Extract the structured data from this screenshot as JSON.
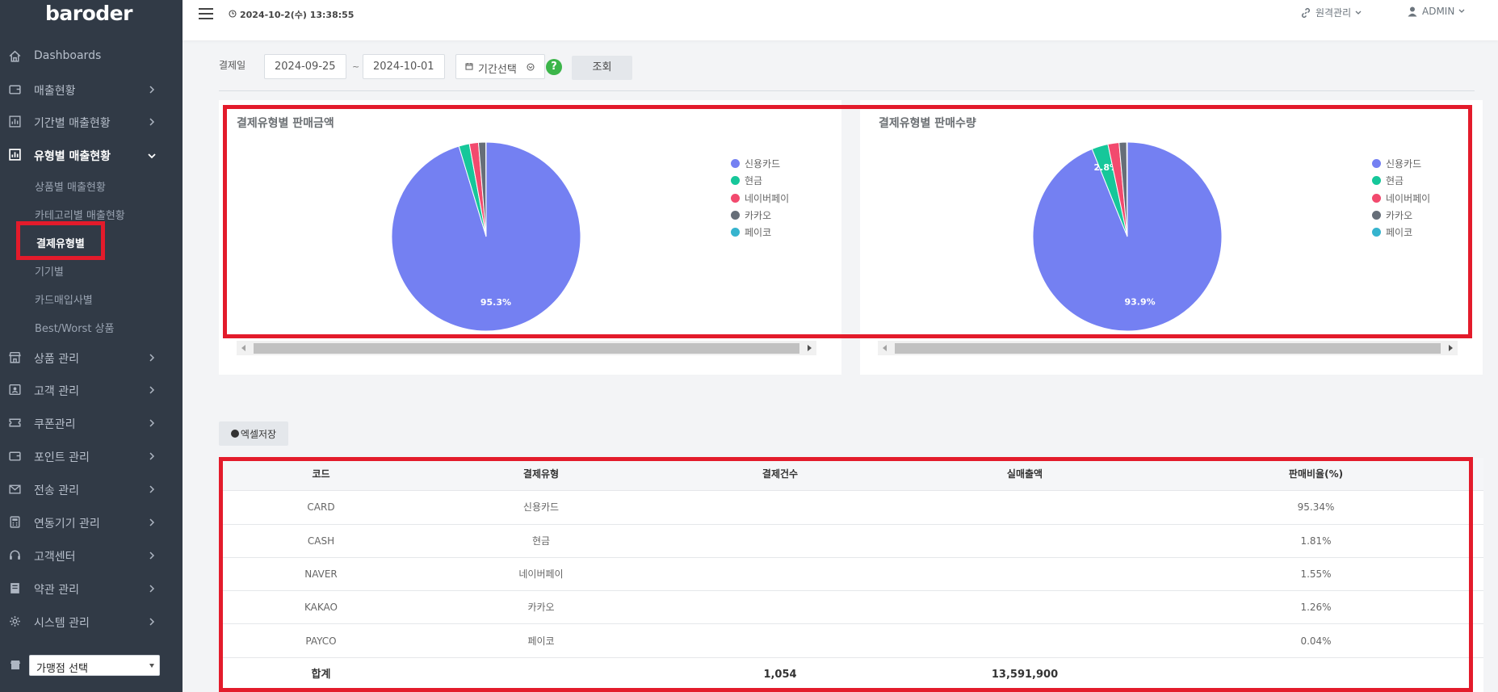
{
  "app": {
    "logo": "baroder"
  },
  "sidebar": {
    "items": [
      {
        "label": "Dashboards",
        "icon": "home-icon",
        "chevron": false
      },
      {
        "label": "매출현황",
        "icon": "wallet-icon",
        "chevron": true
      },
      {
        "label": "기간별 매출현황",
        "icon": "bar-chart-icon",
        "chevron": true
      },
      {
        "label": "유형별 매출현황",
        "icon": "chart-icon",
        "chevron": true,
        "expanded": true,
        "active": true
      },
      {
        "label": "상품 관리",
        "icon": "store-icon",
        "chevron": true
      },
      {
        "label": "고객 관리",
        "icon": "contact-icon",
        "chevron": true
      },
      {
        "label": "쿠폰관리",
        "icon": "ticket-icon",
        "chevron": true
      },
      {
        "label": "포인트 관리",
        "icon": "wallet-icon",
        "chevron": true
      },
      {
        "label": "전송 관리",
        "icon": "mail-icon",
        "chevron": true
      },
      {
        "label": "연동기기 관리",
        "icon": "calculator-icon",
        "chevron": true
      },
      {
        "label": "고객센터",
        "icon": "headset-icon",
        "chevron": true
      },
      {
        "label": "약관 관리",
        "icon": "book-icon",
        "chevron": true
      },
      {
        "label": "시스템 관리",
        "icon": "gear-icon",
        "chevron": true
      }
    ],
    "subitems": [
      {
        "label": "상품별 매출현황"
      },
      {
        "label": "카테고리별 매출현황"
      },
      {
        "label": "결제유형별",
        "current": true
      },
      {
        "label": "기기별"
      },
      {
        "label": "카드매입사별"
      },
      {
        "label": "Best/Worst 상품"
      }
    ],
    "store_select": {
      "value": "가맹점 선택"
    }
  },
  "topbar": {
    "datetime": "2024-10-2(수) 13:38:55",
    "remote_label": "원격관리",
    "user_label": "ADMIN"
  },
  "filter": {
    "label": "결제일",
    "start_date": "2024-09-25",
    "tilde": "~",
    "end_date": "2024-10-01",
    "period_button": "기간선택",
    "help": "?",
    "search_button": "조회"
  },
  "colors": {
    "credit_card": "#7480f2",
    "cash": "#16c79a",
    "naver": "#f24a6e",
    "kakao": "#666e78",
    "payco": "#36b4ce",
    "highlight": "#e31b2b"
  },
  "chart_data": [
    {
      "type": "pie",
      "title": "결제유형별 판매금액",
      "categories": [
        "신용카드",
        "현금",
        "네이버페이",
        "카카오",
        "페이코"
      ],
      "values": [
        95.34,
        1.81,
        1.55,
        1.26,
        0.04
      ],
      "data_labels": [
        "95.3%",
        "",
        "",
        "",
        ""
      ],
      "legend_position": "right"
    },
    {
      "type": "pie",
      "title": "결제유형별 판매수량",
      "categories": [
        "신용카드",
        "현금",
        "네이버페이",
        "카카오",
        "페이코"
      ],
      "values": [
        93.9,
        2.8,
        1.9,
        1.3,
        0.1
      ],
      "data_labels": [
        "93.9%",
        "2.8%",
        "",
        "",
        ""
      ],
      "legend_position": "right"
    }
  ],
  "excel_button": "엑셀저장",
  "table": {
    "headers": [
      "코드",
      "결제유형",
      "결제건수",
      "실매출액",
      "판매비율(%)"
    ],
    "rows": [
      [
        "CARD",
        "신용카드",
        "",
        "",
        "95.34%"
      ],
      [
        "CASH",
        "현금",
        "",
        "",
        "1.81%"
      ],
      [
        "NAVER",
        "네이버페이",
        "",
        "",
        "1.55%"
      ],
      [
        "KAKAO",
        "카카오",
        "",
        "",
        "1.26%"
      ],
      [
        "PAYCO",
        "페이코",
        "",
        "",
        "0.04%"
      ]
    ],
    "total": [
      "합계",
      "",
      "1,054",
      "13,591,900",
      ""
    ]
  }
}
